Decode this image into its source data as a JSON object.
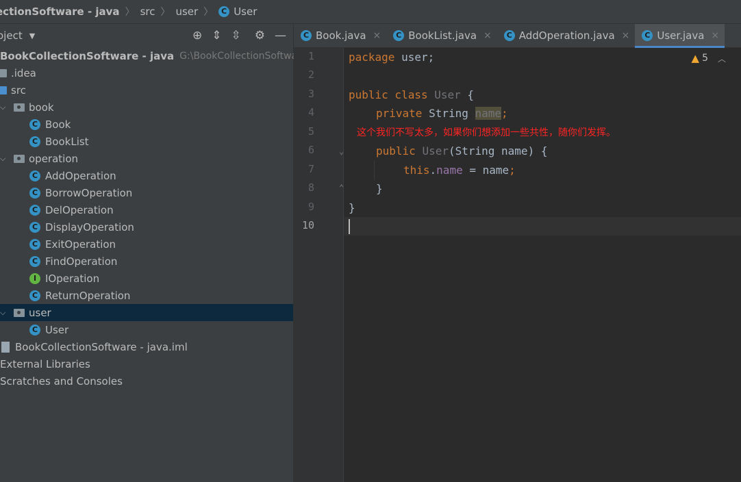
{
  "breadcrumb": {
    "project": "ectionSoftware - java",
    "folder": "src",
    "package": "user",
    "file": "User",
    "file_icon": "C"
  },
  "project_panel": {
    "title": "oject",
    "tools": [
      "target-icon",
      "expand-all-icon",
      "collapse-all-icon",
      "gear-icon",
      "minimize-icon"
    ]
  },
  "tree": {
    "root_name": "BookCollectionSoftware - java",
    "root_path": "G:\\BookCollectionSoftware",
    "idea": ".idea",
    "src": "src",
    "book": "book",
    "book_items": [
      "Book",
      "BookList"
    ],
    "operation": "operation",
    "operation_items": [
      "AddOperation",
      "BorrowOperation",
      "DelOperation",
      "DisplayOperation",
      "ExitOperation",
      "FindOperation",
      "IOperation",
      "ReturnOperation"
    ],
    "user": "user",
    "user_items": [
      "User"
    ],
    "iml": "BookCollectionSoftware - java.iml",
    "ext_libs": "External Libraries",
    "scratches": "Scratches and Consoles",
    "icon_class": "C",
    "icon_interface": "I"
  },
  "tabs": [
    {
      "label": "Book.java",
      "icon": "C",
      "active": false
    },
    {
      "label": "BookList.java",
      "icon": "C",
      "active": false
    },
    {
      "label": "AddOperation.java",
      "icon": "C",
      "active": false
    },
    {
      "label": "User.java",
      "icon": "C",
      "active": true
    }
  ],
  "tab_close": "×",
  "editor": {
    "line_numbers": [
      "1",
      "2",
      "3",
      "4",
      "5",
      "6",
      "7",
      "8",
      "9",
      "10"
    ],
    "warnings": "5",
    "code": {
      "l1_kw": "package",
      "l1_rest": " user;",
      "l3_kw": "public class",
      "l3_name": "User",
      "l3_brace": " {",
      "l4_kw": "private",
      "l4_type": " String ",
      "l4_field": "name",
      "l4_semi": ";",
      "l6_kw": "public",
      "l6_name": "User",
      "l6_rest": "(String name) {",
      "l7_kw": "this",
      "l7_dot": ".",
      "l7_field": "name",
      "l7_rest": " = name",
      "l7_semi": ";",
      "l8": "}",
      "l9": "}"
    },
    "annotation": "这个我们不写太多，如果你们想添加一些共性，随你们发挥。"
  },
  "colors": {
    "keyword": "#cc7832",
    "identifier": "#a9b7c6",
    "field": "#9876aa",
    "annotation": "#ff2424",
    "selection": "#0d293e",
    "tab_underline": "#4a88c7"
  }
}
